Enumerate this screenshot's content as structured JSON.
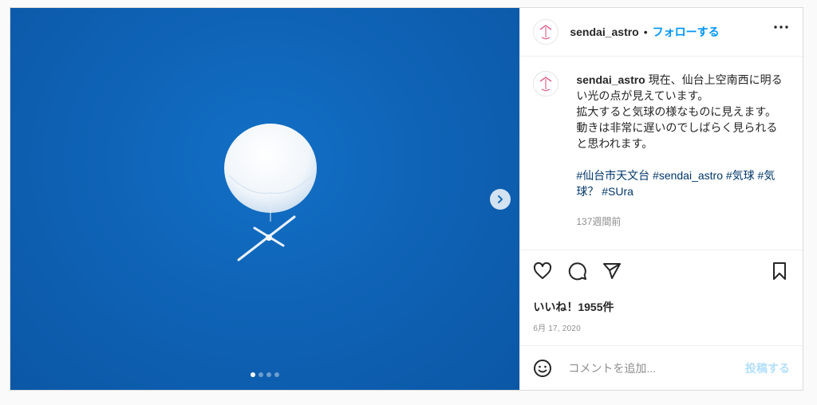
{
  "colors": {
    "accent": "#0095f6",
    "hashtag": "#00376b",
    "muted": "#8e8e8e",
    "sky": "#0f63b6"
  },
  "header": {
    "username": "sendai_astro",
    "separator": "•",
    "follow_label": "フォローする",
    "more_icon": "more-horizontal-icon"
  },
  "carousel": {
    "total_slides": 4,
    "current_slide": 1,
    "next_icon": "chevron-right-icon"
  },
  "caption": {
    "username": "sendai_astro",
    "text": "現在、仙台上空南西に明るい光の点が見えています。\n拡大すると気球の様なものに見えます。\n動きは非常に遅いのでしばらく見られると思われます。\n\n",
    "hashtags": "#仙台市天文台 #sendai_astro #気球 #気球？ #SUra",
    "time_ago": "137週間前"
  },
  "actions": {
    "like_icon": "heart-icon",
    "comment_icon": "comment-icon",
    "share_icon": "paper-plane-icon",
    "save_icon": "bookmark-icon"
  },
  "likes": {
    "text": "いいね！1955件"
  },
  "post_date": "6月 17, 2020",
  "comment": {
    "emoji_icon": "smiley-icon",
    "placeholder": "コメントを追加...",
    "post_label": "投稿する"
  }
}
